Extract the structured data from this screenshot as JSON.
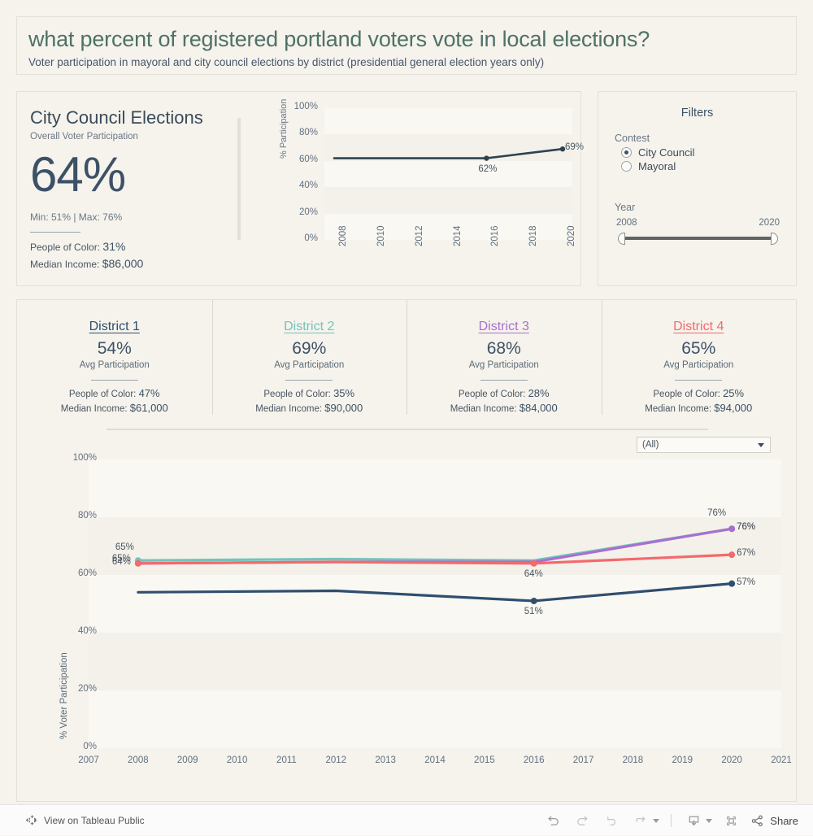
{
  "header": {
    "title": "what percent of registered portland voters vote in local elections?",
    "subtitle": "Voter participation in mayoral and city council elections by district (presidential general election years only)"
  },
  "kpi": {
    "heading": "City Council Elections",
    "subheading": "Overall Voter Participation",
    "big_value": "64%",
    "minmax": "Min: 51% | Max: 76%",
    "poc_label": "People of Color:",
    "poc_value": "31%",
    "income_label": "Median Income:",
    "income_value": "$86,000"
  },
  "filters": {
    "title": "Filters",
    "contest_label": "Contest",
    "options": [
      {
        "label": "City Council",
        "selected": true
      },
      {
        "label": "Mayoral",
        "selected": false
      }
    ],
    "year_label": "Year",
    "year_min": "2008",
    "year_max": "2020"
  },
  "districts": [
    {
      "name": "District 1",
      "pct": "54%",
      "sub": "Avg Participation",
      "poc_label": "People of Color:",
      "poc": "47%",
      "income_label": "Median Income:",
      "income": "$61,000",
      "color": "#2f4f6f"
    },
    {
      "name": "District 2",
      "pct": "69%",
      "sub": "Avg Participation",
      "poc_label": "People of Color:",
      "poc": "35%",
      "income_label": "Median Income:",
      "income": "$90,000",
      "color": "#72c4bb"
    },
    {
      "name": "District 3",
      "pct": "68%",
      "sub": "Avg Participation",
      "poc_label": "People of Color:",
      "poc": "28%",
      "income_label": "Median Income:",
      "income": "$84,000",
      "color": "#a96fd0"
    },
    {
      "name": "District 4",
      "pct": "65%",
      "sub": "Avg Participation",
      "poc_label": "People of Color:",
      "poc": "25%",
      "income_label": "Median Income:",
      "income": "$94,000",
      "color": "#f4696b"
    }
  ],
  "district_select": {
    "value": "(All)"
  },
  "toolbar": {
    "tableau_label": "View on Tableau Public",
    "share_label": "Share",
    "buttons": [
      "undo-icon",
      "redo-icon",
      "revert-icon",
      "refresh-icon",
      "download-icon",
      "fullscreen-icon",
      "share-icon"
    ]
  },
  "chart_data": [
    {
      "type": "line",
      "id": "overall-sparkline",
      "title": "",
      "xlabel": "",
      "ylabel": "% Participation",
      "ylim": [
        0,
        100
      ],
      "yticks": [
        "0%",
        "20%",
        "40%",
        "60%",
        "80%",
        "100%"
      ],
      "xticks": [
        "2008",
        "2010",
        "2012",
        "2014",
        "2016",
        "2018",
        "2020"
      ],
      "xlim": [
        2008,
        2020
      ],
      "grid": true,
      "series": [
        {
          "name": "Overall",
          "color": "#2f4250",
          "x": [
            2008,
            2012,
            2016,
            2020
          ],
          "values": [
            62,
            62,
            62,
            69
          ],
          "labels": {
            "2016": "62%",
            "2020": "69%"
          }
        }
      ]
    },
    {
      "type": "line",
      "id": "district-participation",
      "title": "",
      "xlabel": "",
      "ylabel": "% Voter Participation",
      "ylim": [
        0,
        100
      ],
      "yticks": [
        "0%",
        "20%",
        "40%",
        "60%",
        "80%",
        "100%"
      ],
      "xticks": [
        "2007",
        "2008",
        "2009",
        "2010",
        "2011",
        "2012",
        "2013",
        "2014",
        "2015",
        "2016",
        "2017",
        "2018",
        "2019",
        "2020",
        "2021"
      ],
      "xlim": [
        2007,
        2021
      ],
      "grid": true,
      "x": [
        2008,
        2012,
        2016,
        2020
      ],
      "series": [
        {
          "name": "District 1",
          "color": "#2f4f6f",
          "values": [
            54,
            54.5,
            51,
            57
          ],
          "labels": {
            "2016": "51%",
            "2020": "57%"
          }
        },
        {
          "name": "District 2",
          "color": "#72c4bb",
          "values": [
            65,
            65.5,
            65,
            76
          ],
          "labels": {
            "2008": "65%",
            "2020": "76%"
          }
        },
        {
          "name": "District 3",
          "color": "#a96fd0",
          "values": [
            64,
            64.5,
            64.5,
            76
          ],
          "labels": {
            "2020": "76%"
          }
        },
        {
          "name": "District 4",
          "color": "#f4696b",
          "values": [
            64,
            64.5,
            64,
            67
          ],
          "labels": {
            "2008": "64%",
            "2016": "64%",
            "2020": "67%"
          }
        }
      ]
    }
  ]
}
